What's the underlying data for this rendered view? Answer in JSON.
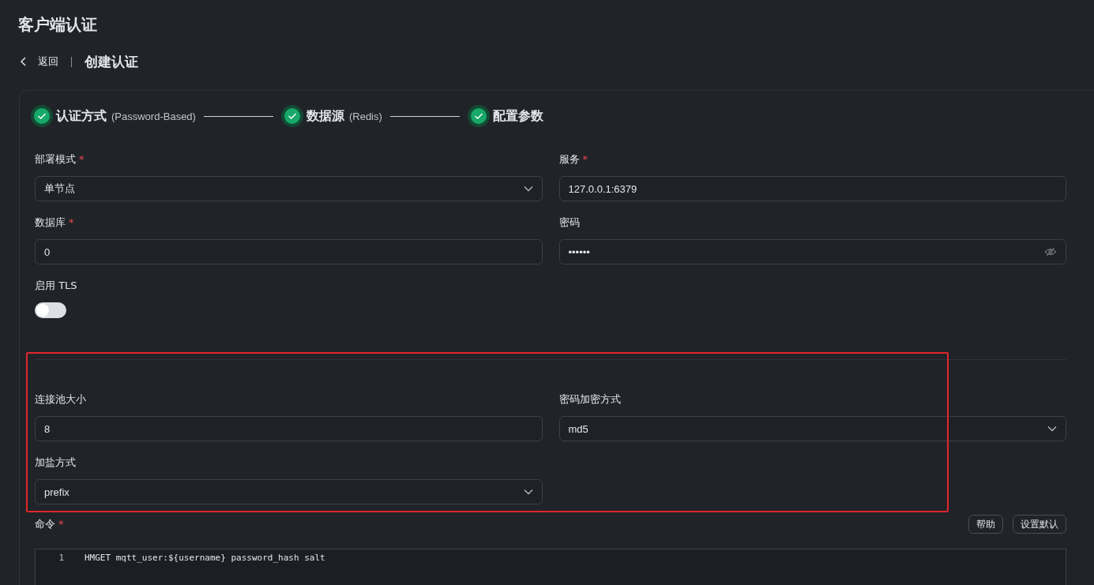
{
  "page_title": "客户端认证",
  "required_mark": "*",
  "breadcrumb": {
    "back": "返回",
    "current": "创建认证"
  },
  "steps": [
    {
      "title": "认证方式",
      "detail": "(Password-Based)",
      "done": true
    },
    {
      "title": "数据源",
      "detail": "(Redis)",
      "done": true
    },
    {
      "title": "配置参数",
      "done": true
    }
  ],
  "basic_fields": [
    {
      "label": "部署模式",
      "required": true,
      "kind": "select",
      "value": "单节点"
    },
    {
      "label": "服务",
      "required": true,
      "kind": "input",
      "value": "127.0.0.1:6379"
    },
    {
      "label": "数据库",
      "required": true,
      "kind": "input",
      "value": "0"
    },
    {
      "label": "密码",
      "required": false,
      "kind": "password",
      "value": "••••••"
    },
    {
      "label": "启用 TLS",
      "required": false,
      "kind": "switch",
      "on": false
    }
  ],
  "advanced_fields": [
    {
      "label": "连接池大小",
      "required": false,
      "kind": "input",
      "value": "8"
    },
    {
      "label": "密码加密方式",
      "required": false,
      "kind": "select",
      "value": "md5"
    },
    {
      "label": "加盐方式",
      "required": false,
      "kind": "select",
      "value": "prefix"
    }
  ],
  "command": {
    "label": "命令",
    "required": true,
    "buttons": [
      "帮助",
      "设置默认"
    ],
    "lines": [
      {
        "number": "1",
        "code": "HMGET mqtt_user:${username} password_hash salt"
      }
    ]
  }
}
